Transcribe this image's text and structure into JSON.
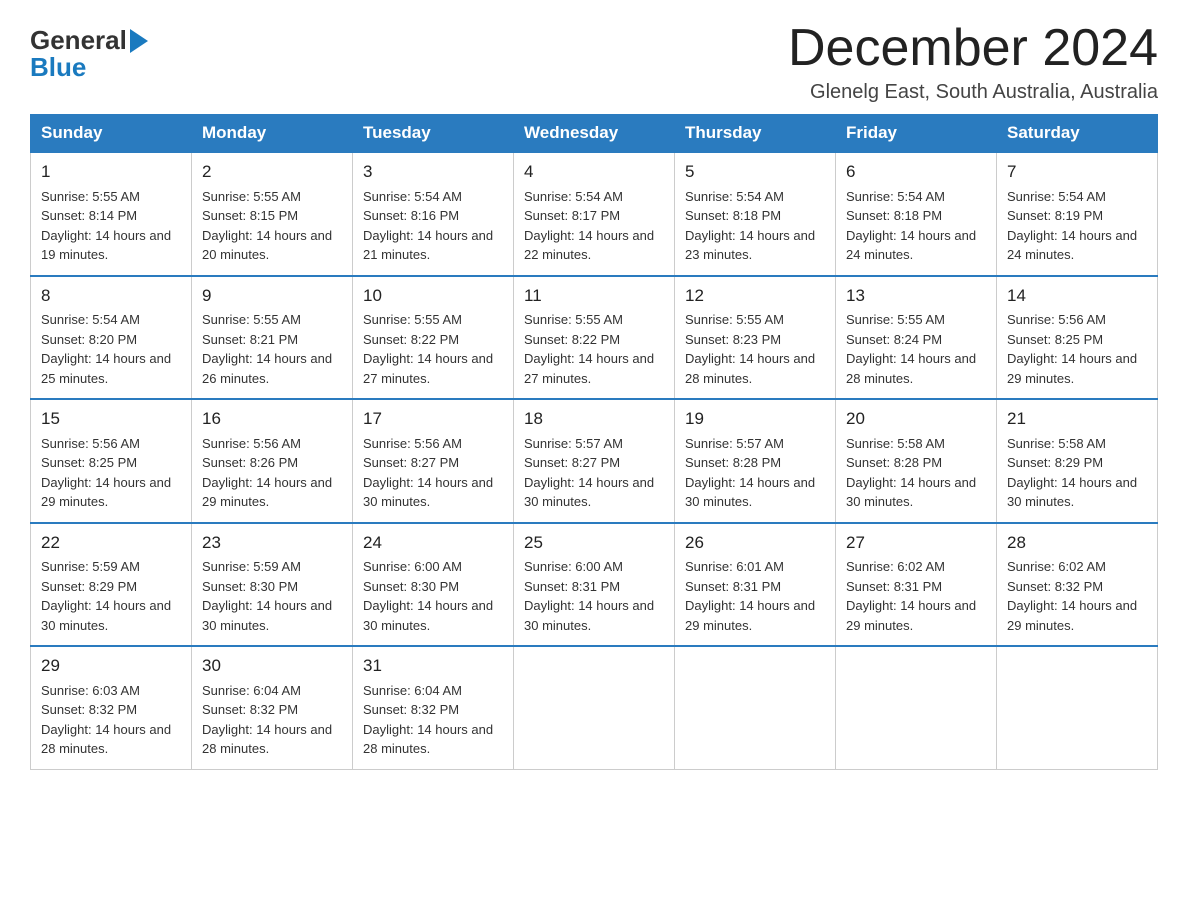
{
  "header": {
    "logo_general": "General",
    "logo_blue": "Blue",
    "month_title": "December 2024",
    "location": "Glenelg East, South Australia, Australia"
  },
  "days_of_week": [
    "Sunday",
    "Monday",
    "Tuesday",
    "Wednesday",
    "Thursday",
    "Friday",
    "Saturday"
  ],
  "weeks": [
    [
      {
        "day": "1",
        "sunrise": "5:55 AM",
        "sunset": "8:14 PM",
        "daylight": "14 hours and 19 minutes."
      },
      {
        "day": "2",
        "sunrise": "5:55 AM",
        "sunset": "8:15 PM",
        "daylight": "14 hours and 20 minutes."
      },
      {
        "day": "3",
        "sunrise": "5:54 AM",
        "sunset": "8:16 PM",
        "daylight": "14 hours and 21 minutes."
      },
      {
        "day": "4",
        "sunrise": "5:54 AM",
        "sunset": "8:17 PM",
        "daylight": "14 hours and 22 minutes."
      },
      {
        "day": "5",
        "sunrise": "5:54 AM",
        "sunset": "8:18 PM",
        "daylight": "14 hours and 23 minutes."
      },
      {
        "day": "6",
        "sunrise": "5:54 AM",
        "sunset": "8:18 PM",
        "daylight": "14 hours and 24 minutes."
      },
      {
        "day": "7",
        "sunrise": "5:54 AM",
        "sunset": "8:19 PM",
        "daylight": "14 hours and 24 minutes."
      }
    ],
    [
      {
        "day": "8",
        "sunrise": "5:54 AM",
        "sunset": "8:20 PM",
        "daylight": "14 hours and 25 minutes."
      },
      {
        "day": "9",
        "sunrise": "5:55 AM",
        "sunset": "8:21 PM",
        "daylight": "14 hours and 26 minutes."
      },
      {
        "day": "10",
        "sunrise": "5:55 AM",
        "sunset": "8:22 PM",
        "daylight": "14 hours and 27 minutes."
      },
      {
        "day": "11",
        "sunrise": "5:55 AM",
        "sunset": "8:22 PM",
        "daylight": "14 hours and 27 minutes."
      },
      {
        "day": "12",
        "sunrise": "5:55 AM",
        "sunset": "8:23 PM",
        "daylight": "14 hours and 28 minutes."
      },
      {
        "day": "13",
        "sunrise": "5:55 AM",
        "sunset": "8:24 PM",
        "daylight": "14 hours and 28 minutes."
      },
      {
        "day": "14",
        "sunrise": "5:56 AM",
        "sunset": "8:25 PM",
        "daylight": "14 hours and 29 minutes."
      }
    ],
    [
      {
        "day": "15",
        "sunrise": "5:56 AM",
        "sunset": "8:25 PM",
        "daylight": "14 hours and 29 minutes."
      },
      {
        "day": "16",
        "sunrise": "5:56 AM",
        "sunset": "8:26 PM",
        "daylight": "14 hours and 29 minutes."
      },
      {
        "day": "17",
        "sunrise": "5:56 AM",
        "sunset": "8:27 PM",
        "daylight": "14 hours and 30 minutes."
      },
      {
        "day": "18",
        "sunrise": "5:57 AM",
        "sunset": "8:27 PM",
        "daylight": "14 hours and 30 minutes."
      },
      {
        "day": "19",
        "sunrise": "5:57 AM",
        "sunset": "8:28 PM",
        "daylight": "14 hours and 30 minutes."
      },
      {
        "day": "20",
        "sunrise": "5:58 AM",
        "sunset": "8:28 PM",
        "daylight": "14 hours and 30 minutes."
      },
      {
        "day": "21",
        "sunrise": "5:58 AM",
        "sunset": "8:29 PM",
        "daylight": "14 hours and 30 minutes."
      }
    ],
    [
      {
        "day": "22",
        "sunrise": "5:59 AM",
        "sunset": "8:29 PM",
        "daylight": "14 hours and 30 minutes."
      },
      {
        "day": "23",
        "sunrise": "5:59 AM",
        "sunset": "8:30 PM",
        "daylight": "14 hours and 30 minutes."
      },
      {
        "day": "24",
        "sunrise": "6:00 AM",
        "sunset": "8:30 PM",
        "daylight": "14 hours and 30 minutes."
      },
      {
        "day": "25",
        "sunrise": "6:00 AM",
        "sunset": "8:31 PM",
        "daylight": "14 hours and 30 minutes."
      },
      {
        "day": "26",
        "sunrise": "6:01 AM",
        "sunset": "8:31 PM",
        "daylight": "14 hours and 29 minutes."
      },
      {
        "day": "27",
        "sunrise": "6:02 AM",
        "sunset": "8:31 PM",
        "daylight": "14 hours and 29 minutes."
      },
      {
        "day": "28",
        "sunrise": "6:02 AM",
        "sunset": "8:32 PM",
        "daylight": "14 hours and 29 minutes."
      }
    ],
    [
      {
        "day": "29",
        "sunrise": "6:03 AM",
        "sunset": "8:32 PM",
        "daylight": "14 hours and 28 minutes."
      },
      {
        "day": "30",
        "sunrise": "6:04 AM",
        "sunset": "8:32 PM",
        "daylight": "14 hours and 28 minutes."
      },
      {
        "day": "31",
        "sunrise": "6:04 AM",
        "sunset": "8:32 PM",
        "daylight": "14 hours and 28 minutes."
      },
      null,
      null,
      null,
      null
    ]
  ],
  "labels": {
    "sunrise_prefix": "Sunrise: ",
    "sunset_prefix": "Sunset: ",
    "daylight_prefix": "Daylight: "
  }
}
